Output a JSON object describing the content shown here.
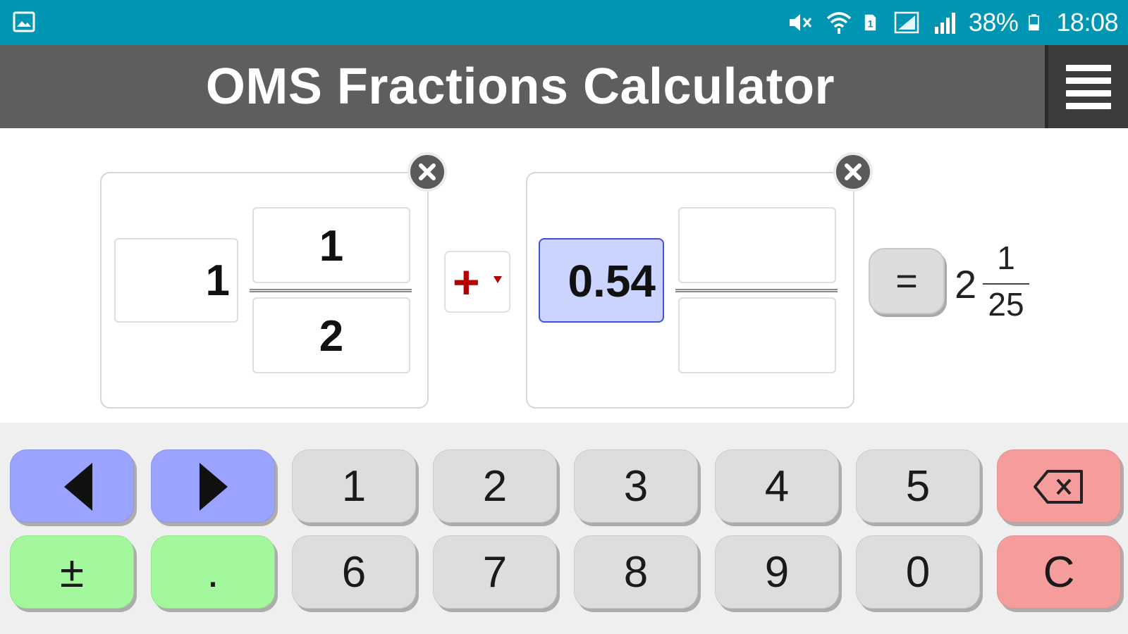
{
  "status_bar": {
    "battery": "38%",
    "time": "18:08",
    "icons": [
      "gallery-icon",
      "mute-icon",
      "wifi-icon",
      "sim-icon",
      "signal-icon",
      "signal-icon",
      "battery-icon"
    ]
  },
  "header": {
    "title": "OMS Fractions Calculator",
    "menu_icon": "hamburger-menu-icon"
  },
  "fraction1": {
    "whole": "1",
    "numerator": "1",
    "denominator": "2"
  },
  "operator": {
    "symbol": "+"
  },
  "fraction2": {
    "whole": "0.54",
    "numerator": "",
    "denominator": ""
  },
  "equals_label": "=",
  "result": {
    "whole": "2",
    "numerator": "1",
    "denominator": "25"
  },
  "keypad": {
    "row1": [
      "1",
      "2",
      "3",
      "4",
      "5"
    ],
    "row2": [
      "6",
      "7",
      "8",
      "9",
      "0"
    ],
    "plus_minus": "±",
    "decimal": ".",
    "clear": "C",
    "left_icon": "left-arrow-icon",
    "right_icon": "right-arrow-icon",
    "backspace_icon": "backspace-icon"
  },
  "colors": {
    "status_bar": "#0096b3",
    "title_bar": "#5e5e5e",
    "key_blue": "#9aa3ff",
    "key_gray": "#dddddd",
    "key_red": "#f59d9d",
    "key_green": "#a3f79d",
    "operator": "#b30000",
    "active_field": "#cbd3ff"
  }
}
